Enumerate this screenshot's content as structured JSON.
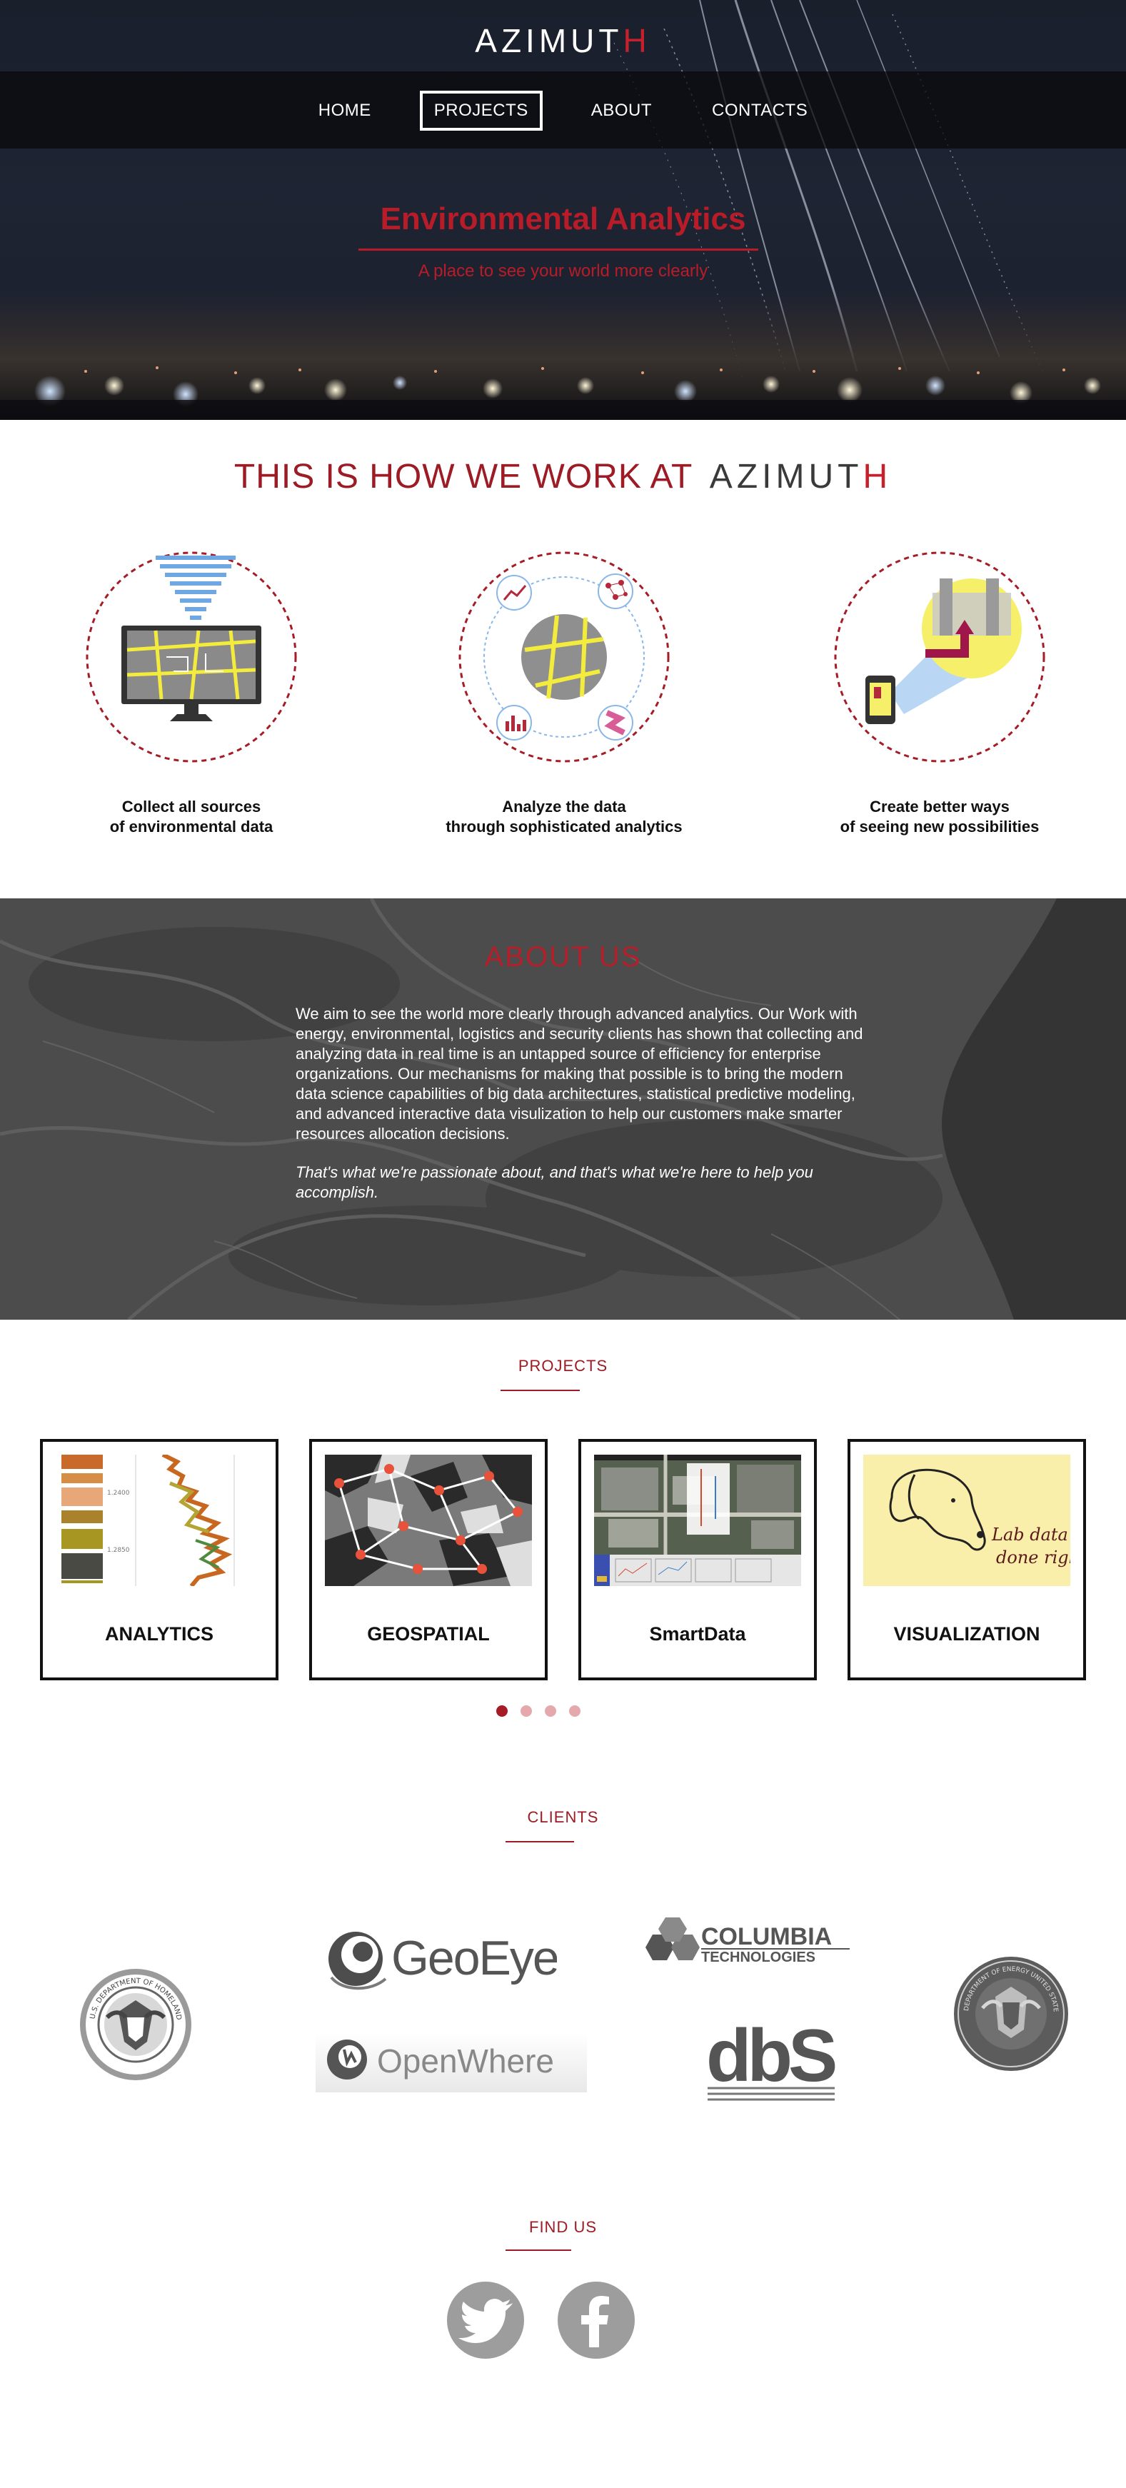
{
  "header": {
    "logo": "AZIMUTH",
    "nav": [
      {
        "label": "HOME",
        "active": false
      },
      {
        "label": "PROJECTS",
        "active": true
      },
      {
        "label": "ABOUT",
        "active": false
      },
      {
        "label": "CONTACTS",
        "active": false
      }
    ],
    "hero_title": "Environmental Analytics",
    "hero_subtitle": "A place to see your world more clearly"
  },
  "how_we_work": {
    "title": "THIS IS HOW WE WORK AT",
    "brand": "AZIMUTH",
    "steps": [
      {
        "icon": "data-collection-monitor-icon",
        "caption": "Collect all sources\nof  environmental data"
      },
      {
        "icon": "analytics-network-icon",
        "caption": "Analyze the data\nthrough sophisticated analytics"
      },
      {
        "icon": "mobile-map-view-icon",
        "caption": "Create better ways\nof seeing new possibilities"
      }
    ]
  },
  "about": {
    "title": "ABOUT US",
    "paragraph": "We aim to see the world more clearly through advanced analytics. Our Work with energy, environmental, logistics and security clients has shown that collecting and analyzing data in real time is an untapped source of efficiency for enterprise organizations. Our mechanisms for making that possible is to bring the modern data science capabilities of big data architectures, statistical predictive modeling, and advanced interactive data visulization to help our customers make smarter resources allocation decisions.",
    "tagline": "That's what we're passionate about, and that's what we're here to help you accomplish."
  },
  "projects": {
    "title": "PROJECTS",
    "cards": [
      {
        "label": "ANALYTICS",
        "thumb": "well-log-chart",
        "tick_1": "1.2400",
        "tick_2": "1.2850"
      },
      {
        "label": "GEOSPATIAL",
        "thumb": "terrain-network-map"
      },
      {
        "label": "SmartData",
        "thumb": "aerial-dashboard"
      },
      {
        "label": "VISUALIZATION",
        "thumb": "lab-dog-sketch",
        "thumb_text_1": "Lab data",
        "thumb_text_2": "done right."
      }
    ],
    "pagination": {
      "total": 4,
      "active": 0
    }
  },
  "clients": {
    "title": "CLIENTS",
    "logos": [
      {
        "name": "homeland-security-seal",
        "text": "U.S. DEPARTMENT OF HOMELAND SECURITY"
      },
      {
        "name": "geoeye-logo",
        "text": "GeoEye"
      },
      {
        "name": "openwhere-logo",
        "text": "OpenWhere"
      },
      {
        "name": "columbia-technologies-logo",
        "text_1": "COLUMBIA",
        "text_2": "TECHNOLOGIES"
      },
      {
        "name": "dbs-logo",
        "text": "dbS"
      },
      {
        "name": "department-of-energy-seal",
        "text": "DEPARTMENT OF ENERGY UNITED STATES OF AMERICA"
      }
    ]
  },
  "find_us": {
    "title": "FIND US",
    "links": [
      {
        "icon": "twitter-icon"
      },
      {
        "icon": "facebook-icon"
      }
    ]
  },
  "colors": {
    "accent": "#9c1b24",
    "hero_red": "#b81c28",
    "gray_icon": "#9d9d9d"
  }
}
